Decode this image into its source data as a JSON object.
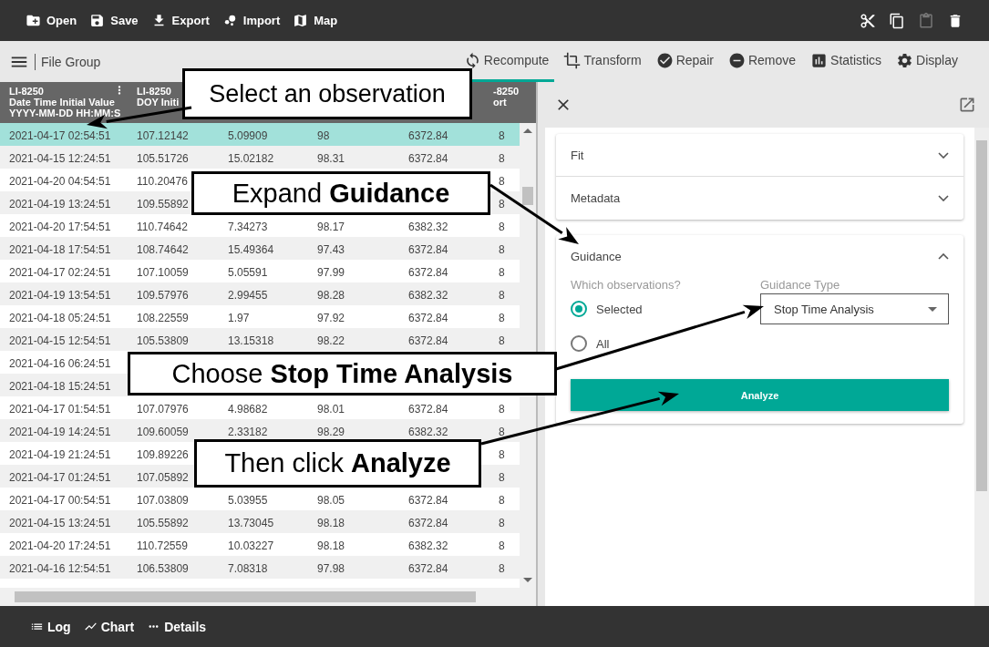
{
  "toolbar": {
    "actions": [
      {
        "label": "Open"
      },
      {
        "label": "Save"
      },
      {
        "label": "Export"
      },
      {
        "label": "Import"
      },
      {
        "label": "Map"
      }
    ],
    "edit_tools": [
      {
        "disabled": false
      },
      {
        "disabled": false
      },
      {
        "disabled": true
      },
      {
        "disabled": false
      }
    ]
  },
  "sub_bar": {
    "menu_label": "File Group",
    "tabs": [
      {
        "label": "Recompute",
        "selected": true
      },
      {
        "label": "Transform",
        "selected": false
      },
      {
        "label": "Repair",
        "selected": false
      },
      {
        "label": "Remove",
        "selected": false
      },
      {
        "label": "Statistics",
        "selected": false
      },
      {
        "label": "Display",
        "selected": false
      }
    ]
  },
  "table": {
    "columns": [
      {
        "header": [
          "LI-8250",
          "Date Time Initial Value",
          "YYYY-MM-DD HH:MM:S"
        ]
      },
      {
        "header": [
          "LI-8250",
          "DOY Initi"
        ]
      },
      {},
      {},
      {},
      {
        "header": [
          "-8250",
          "ort"
        ]
      }
    ],
    "rows": [
      {
        "selected": true,
        "cells": [
          "2021-04-17 02:54:51",
          "107.12142",
          "5.09909",
          "98",
          "6372.84",
          "8"
        ]
      },
      {
        "selected": false,
        "cells": [
          "2021-04-15 12:24:51",
          "105.51726",
          "15.02182",
          "98.31",
          "6372.84",
          "8"
        ]
      },
      {
        "selected": false,
        "cells": [
          "2021-04-20 04:54:51",
          "110.20476",
          null,
          null,
          null,
          "8"
        ]
      },
      {
        "selected": false,
        "cells": [
          "2021-04-19 13:24:51",
          "109.55892",
          null,
          null,
          null,
          "8"
        ]
      },
      {
        "selected": false,
        "cells": [
          "2021-04-20 17:54:51",
          "110.74642",
          "7.34273",
          "98.17",
          "6382.32",
          "8"
        ]
      },
      {
        "selected": false,
        "cells": [
          "2021-04-18 17:54:51",
          "108.74642",
          "15.49364",
          "97.43",
          "6372.84",
          "8"
        ]
      },
      {
        "selected": false,
        "cells": [
          "2021-04-17 02:24:51",
          "107.10059",
          "5.05591",
          "97.99",
          "6372.84",
          "8"
        ]
      },
      {
        "selected": false,
        "cells": [
          "2021-04-19 13:54:51",
          "109.57976",
          "2.99455",
          "98.28",
          "6382.32",
          "8"
        ]
      },
      {
        "selected": false,
        "cells": [
          "2021-04-18 05:24:51",
          "108.22559",
          "1.97",
          "97.92",
          "6372.84",
          "8"
        ]
      },
      {
        "selected": false,
        "cells": [
          "2021-04-15 12:54:51",
          "105.53809",
          "13.15318",
          "98.22",
          "6372.84",
          "8"
        ]
      },
      {
        "selected": false,
        "cells": [
          "2021-04-16 06:24:51",
          null,
          null,
          null,
          null,
          null
        ]
      },
      {
        "selected": false,
        "cells": [
          "2021-04-18 15:24:51",
          null,
          null,
          null,
          null,
          null
        ]
      },
      {
        "selected": false,
        "cells": [
          "2021-04-17 01:54:51",
          "107.07976",
          "4.98682",
          "98.01",
          "6372.84",
          "8"
        ]
      },
      {
        "selected": false,
        "cells": [
          "2021-04-19 14:24:51",
          "109.60059",
          "2.33182",
          "98.29",
          "6382.32",
          "8"
        ]
      },
      {
        "selected": false,
        "cells": [
          "2021-04-19 21:24:51",
          "109.89226",
          null,
          null,
          null,
          "8"
        ]
      },
      {
        "selected": false,
        "cells": [
          "2021-04-17 01:24:51",
          "107.05892",
          null,
          null,
          null,
          "8"
        ]
      },
      {
        "selected": false,
        "cells": [
          "2021-04-17 00:54:51",
          "107.03809",
          "5.03955",
          "98.05",
          "6372.84",
          "8"
        ]
      },
      {
        "selected": false,
        "cells": [
          "2021-04-15 13:24:51",
          "105.55892",
          "13.73045",
          "98.18",
          "6372.84",
          "8"
        ]
      },
      {
        "selected": false,
        "cells": [
          "2021-04-20 17:24:51",
          "110.72559",
          "10.03227",
          "98.18",
          "6382.32",
          "8"
        ]
      },
      {
        "selected": false,
        "cells": [
          "2021-04-16 12:54:51",
          "106.53809",
          "7.08318",
          "97.98",
          "6372.84",
          "8"
        ]
      }
    ]
  },
  "panel": {
    "sections": [
      {
        "kind": "collapsed",
        "title": "Fit",
        "expanded": false
      },
      {
        "kind": "collapsed",
        "title": "Metadata",
        "expanded": false
      },
      {
        "kind": "guidance",
        "title": "Guidance",
        "expanded": true,
        "question": "Which observations?",
        "options": [
          {
            "label": "Selected",
            "selected": true
          },
          {
            "label": "All",
            "selected": false
          }
        ],
        "type_field": {
          "label": "Guidance Type",
          "value": "Stop Time Analysis"
        },
        "button": "Analyze"
      }
    ]
  },
  "callouts": [
    {
      "text": "Select an observation"
    },
    {
      "text": "Expand **Guidance**"
    },
    {
      "text": "Choose **Stop Time Analysis**"
    },
    {
      "text": "Then click **Analyze**"
    }
  ],
  "bottom_bar": {
    "items": [
      {
        "label": "Log"
      },
      {
        "label": "Chart"
      },
      {
        "label": "Details"
      }
    ]
  }
}
